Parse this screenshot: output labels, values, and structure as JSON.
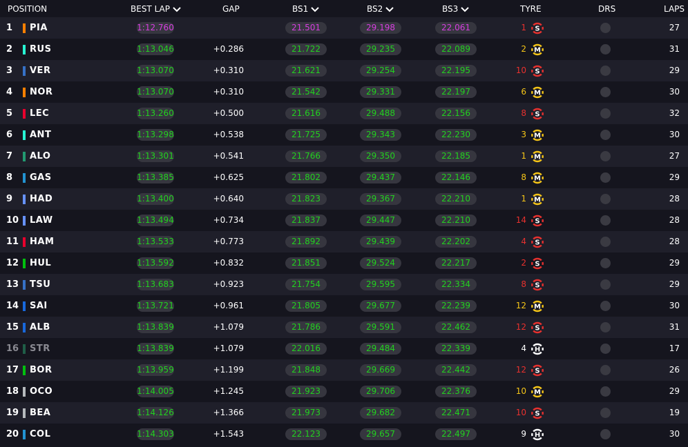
{
  "header": {
    "position": "POSITION",
    "best_lap": "BEST LAP",
    "gap": "GAP",
    "bs1": "BS1",
    "bs2": "BS2",
    "bs3": "BS3",
    "tyre": "TYRE",
    "drs": "DRS",
    "laps": "LAPS"
  },
  "colors": {
    "personal_best": "#22d11f",
    "overall_best": "#d63ee0",
    "soft": "#e8312e",
    "medium": "#f5c518",
    "hard": "#ffffff"
  },
  "rows": [
    {
      "pos": "1",
      "driver": "PIA",
      "team_color": "#ff8000",
      "best": "1:12.760",
      "best_purple": true,
      "gap": "",
      "bs1": "21.501",
      "bs1_purple": true,
      "bs2": "29.198",
      "bs2_purple": true,
      "bs3": "22.061",
      "bs3_purple": true,
      "tyre_age": "1",
      "tyre": "S",
      "laps": "27"
    },
    {
      "pos": "2",
      "driver": "RUS",
      "team_color": "#27f4d2",
      "best": "1:13.046",
      "gap": "+0.286",
      "bs1": "21.722",
      "bs2": "29.235",
      "bs3": "22.089",
      "tyre_age": "2",
      "tyre": "M",
      "laps": "31"
    },
    {
      "pos": "3",
      "driver": "VER",
      "team_color": "#3671c6",
      "best": "1:13.070",
      "gap": "+0.310",
      "bs1": "21.621",
      "bs2": "29.254",
      "bs3": "22.195",
      "tyre_age": "10",
      "tyre": "S",
      "laps": "29"
    },
    {
      "pos": "4",
      "driver": "NOR",
      "team_color": "#ff8000",
      "best": "1:13.070",
      "gap": "+0.310",
      "bs1": "21.542",
      "bs2": "29.331",
      "bs3": "22.197",
      "tyre_age": "6",
      "tyre": "M",
      "laps": "30"
    },
    {
      "pos": "5",
      "driver": "LEC",
      "team_color": "#e8002d",
      "best": "1:13.260",
      "gap": "+0.500",
      "bs1": "21.616",
      "bs2": "29.488",
      "bs3": "22.156",
      "tyre_age": "8",
      "tyre": "S",
      "laps": "32"
    },
    {
      "pos": "6",
      "driver": "ANT",
      "team_color": "#27f4d2",
      "best": "1:13.298",
      "gap": "+0.538",
      "bs1": "21.725",
      "bs2": "29.343",
      "bs3": "22.230",
      "tyre_age": "3",
      "tyre": "M",
      "laps": "30"
    },
    {
      "pos": "7",
      "driver": "ALO",
      "team_color": "#229971",
      "best": "1:13.301",
      "gap": "+0.541",
      "bs1": "21.766",
      "bs2": "29.350",
      "bs3": "22.185",
      "tyre_age": "1",
      "tyre": "M",
      "laps": "27"
    },
    {
      "pos": "8",
      "driver": "GAS",
      "team_color": "#2293d1",
      "best": "1:13.385",
      "gap": "+0.625",
      "bs1": "21.802",
      "bs2": "29.437",
      "bs3": "22.146",
      "tyre_age": "8",
      "tyre": "M",
      "laps": "29"
    },
    {
      "pos": "9",
      "driver": "HAD",
      "team_color": "#6692ff",
      "best": "1:13.400",
      "gap": "+0.640",
      "bs1": "21.823",
      "bs2": "29.367",
      "bs3": "22.210",
      "tyre_age": "1",
      "tyre": "M",
      "laps": "28"
    },
    {
      "pos": "10",
      "driver": "LAW",
      "team_color": "#6692ff",
      "best": "1:13.494",
      "gap": "+0.734",
      "bs1": "21.837",
      "bs2": "29.447",
      "bs3": "22.210",
      "tyre_age": "14",
      "tyre": "S",
      "laps": "28"
    },
    {
      "pos": "11",
      "driver": "HAM",
      "team_color": "#e8002d",
      "best": "1:13.533",
      "gap": "+0.773",
      "bs1": "21.892",
      "bs2": "29.439",
      "bs3": "22.202",
      "tyre_age": "4",
      "tyre": "S",
      "laps": "28"
    },
    {
      "pos": "12",
      "driver": "HUL",
      "team_color": "#01c00e",
      "best": "1:13.592",
      "gap": "+0.832",
      "bs1": "21.851",
      "bs2": "29.524",
      "bs3": "22.217",
      "tyre_age": "2",
      "tyre": "S",
      "laps": "29"
    },
    {
      "pos": "13",
      "driver": "TSU",
      "team_color": "#3671c6",
      "best": "1:13.683",
      "gap": "+0.923",
      "bs1": "21.754",
      "bs2": "29.595",
      "bs3": "22.334",
      "tyre_age": "8",
      "tyre": "S",
      "laps": "29"
    },
    {
      "pos": "14",
      "driver": "SAI",
      "team_color": "#1868db",
      "best": "1:13.721",
      "gap": "+0.961",
      "bs1": "21.805",
      "bs2": "29.677",
      "bs3": "22.239",
      "tyre_age": "12",
      "tyre": "M",
      "laps": "30"
    },
    {
      "pos": "15",
      "driver": "ALB",
      "team_color": "#1868db",
      "best": "1:13.839",
      "gap": "+1.079",
      "bs1": "21.786",
      "bs2": "29.591",
      "bs3": "22.462",
      "tyre_age": "12",
      "tyre": "S",
      "laps": "31"
    },
    {
      "pos": "16",
      "driver": "STR",
      "team_color": "#1f5e47",
      "best": "1:13.839",
      "gap": "+1.079",
      "bs1": "22.016",
      "bs2": "29.484",
      "bs3": "22.339",
      "tyre_age": "4",
      "tyre": "H",
      "laps": "17",
      "retired": true
    },
    {
      "pos": "17",
      "driver": "BOR",
      "team_color": "#01c00e",
      "best": "1:13.959",
      "gap": "+1.199",
      "bs1": "21.848",
      "bs2": "29.669",
      "bs3": "22.442",
      "tyre_age": "12",
      "tyre": "S",
      "laps": "26"
    },
    {
      "pos": "18",
      "driver": "OCO",
      "team_color": "#b6babd",
      "best": "1:14.005",
      "gap": "+1.245",
      "bs1": "21.923",
      "bs2": "29.706",
      "bs3": "22.376",
      "tyre_age": "10",
      "tyre": "M",
      "laps": "29"
    },
    {
      "pos": "19",
      "driver": "BEA",
      "team_color": "#b6babd",
      "best": "1:14.126",
      "gap": "+1.366",
      "bs1": "21.973",
      "bs2": "29.682",
      "bs3": "22.471",
      "tyre_age": "10",
      "tyre": "S",
      "laps": "19"
    },
    {
      "pos": "20",
      "driver": "COL",
      "team_color": "#2293d1",
      "best": "1:14.303",
      "gap": "+1.543",
      "bs1": "22.123",
      "bs2": "29.657",
      "bs3": "22.497",
      "tyre_age": "9",
      "tyre": "H",
      "laps": "30"
    }
  ]
}
